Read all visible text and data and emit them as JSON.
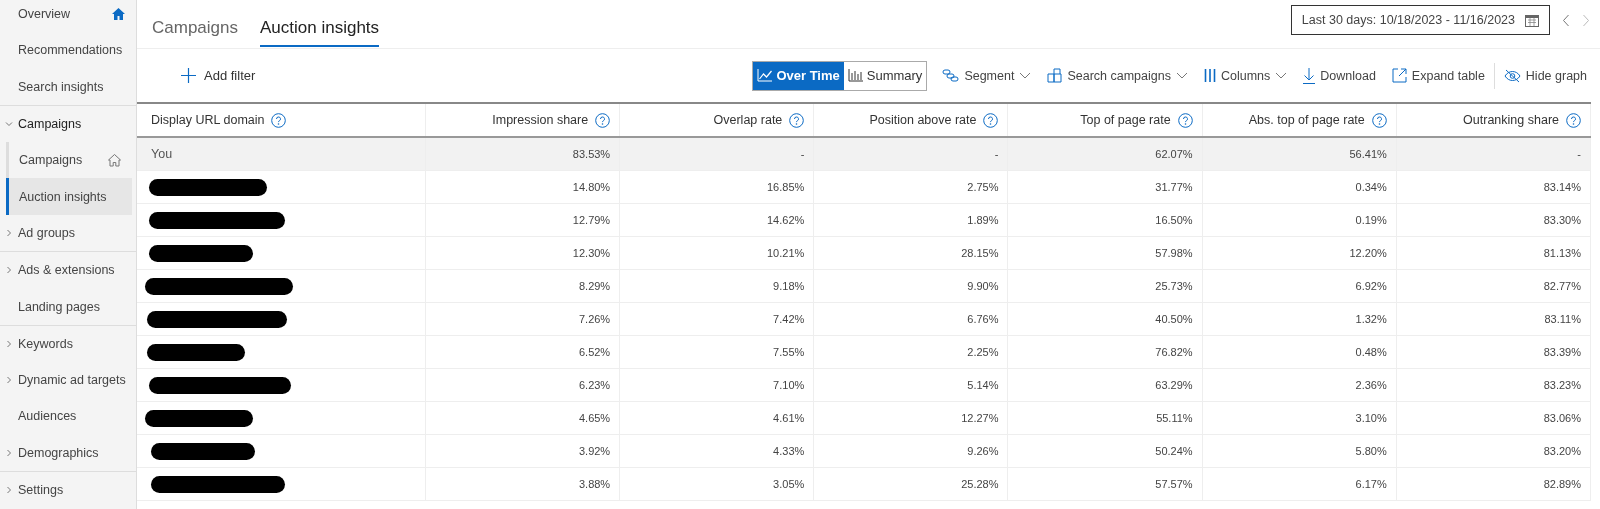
{
  "sidebar": {
    "sections": [
      {
        "items": [
          {
            "label": "Overview",
            "selected": false
          },
          {
            "label": "Recommendations",
            "selected": false
          },
          {
            "label": "Search insights",
            "selected": false
          }
        ]
      },
      {
        "items": [
          {
            "label": "Campaigns",
            "selected": false,
            "expanded": true,
            "children": [
              {
                "label": "Campaigns",
                "selected": false
              },
              {
                "label": "Auction insights",
                "selected": true
              }
            ]
          },
          {
            "label": "Ad groups",
            "selected": false,
            "expanded": false
          }
        ]
      },
      {
        "items": [
          {
            "label": "Ads & extensions",
            "selected": false,
            "expanded": false
          },
          {
            "label": "Landing pages",
            "selected": false
          }
        ]
      },
      {
        "items": [
          {
            "label": "Keywords",
            "selected": false,
            "expanded": false
          },
          {
            "label": "Dynamic ad targets",
            "selected": false,
            "expanded": false
          },
          {
            "label": "Audiences",
            "selected": false
          },
          {
            "label": "Demographics",
            "selected": false,
            "expanded": false
          }
        ]
      },
      {
        "items": [
          {
            "label": "Settings",
            "selected": false,
            "expanded": false
          }
        ]
      }
    ]
  },
  "tabs": [
    {
      "label": "Campaigns",
      "selected": false
    },
    {
      "label": "Auction insights",
      "selected": true
    }
  ],
  "date_range": {
    "value": "Last 30 days: 10/18/2023 - 11/16/2023"
  },
  "toolbar": {
    "add_filter": "Add filter",
    "view_toggle": [
      {
        "label": "Over Time",
        "selected": true
      },
      {
        "label": "Summary",
        "selected": false
      }
    ],
    "actions": [
      {
        "label": "Segment",
        "kind": "segment",
        "dropdown": true
      },
      {
        "label": "Search campaigns",
        "kind": "campaigns",
        "dropdown": true
      },
      {
        "label": "Columns",
        "kind": "columns",
        "dropdown": true
      },
      {
        "label": "Download",
        "kind": "download",
        "dropdown": false
      },
      {
        "label": "Expand table",
        "kind": "expand",
        "dropdown": false
      },
      {
        "label": "Hide graph",
        "kind": "hide",
        "dropdown": false
      }
    ]
  },
  "table": {
    "columns": [
      "Display URL domain",
      "Impression share",
      "Overlap rate",
      "Position above rate",
      "Top of page rate",
      "Abs. top of page rate",
      "Outranking share"
    ],
    "rows": [
      {
        "kind": "you",
        "domain": "You",
        "values": [
          "83.53%",
          "-",
          "-",
          "62.07%",
          "56.41%",
          "-"
        ]
      },
      {
        "kind": "redacted",
        "values": [
          "14.80%",
          "16.85%",
          "2.75%",
          "31.77%",
          "0.34%",
          "83.14%"
        ]
      },
      {
        "kind": "redacted",
        "values": [
          "12.79%",
          "14.62%",
          "1.89%",
          "16.50%",
          "0.19%",
          "83.30%"
        ]
      },
      {
        "kind": "redacted",
        "values": [
          "12.30%",
          "10.21%",
          "28.15%",
          "57.98%",
          "12.20%",
          "81.13%"
        ]
      },
      {
        "kind": "redacted",
        "values": [
          "8.29%",
          "9.18%",
          "9.90%",
          "25.73%",
          "6.92%",
          "82.77%"
        ]
      },
      {
        "kind": "redacted",
        "values": [
          "7.26%",
          "7.42%",
          "6.76%",
          "40.50%",
          "1.32%",
          "83.11%"
        ]
      },
      {
        "kind": "redacted",
        "values": [
          "6.52%",
          "7.55%",
          "2.25%",
          "76.82%",
          "0.48%",
          "83.39%"
        ]
      },
      {
        "kind": "redacted",
        "values": [
          "6.23%",
          "7.10%",
          "5.14%",
          "63.29%",
          "2.36%",
          "83.23%"
        ]
      },
      {
        "kind": "redacted",
        "values": [
          "4.65%",
          "4.61%",
          "12.27%",
          "55.11%",
          "3.10%",
          "83.06%"
        ]
      },
      {
        "kind": "redacted",
        "values": [
          "3.92%",
          "4.33%",
          "9.26%",
          "50.24%",
          "5.80%",
          "83.20%"
        ]
      },
      {
        "kind": "redacted",
        "values": [
          "3.88%",
          "3.05%",
          "25.28%",
          "57.57%",
          "6.17%",
          "82.89%"
        ]
      }
    ]
  }
}
